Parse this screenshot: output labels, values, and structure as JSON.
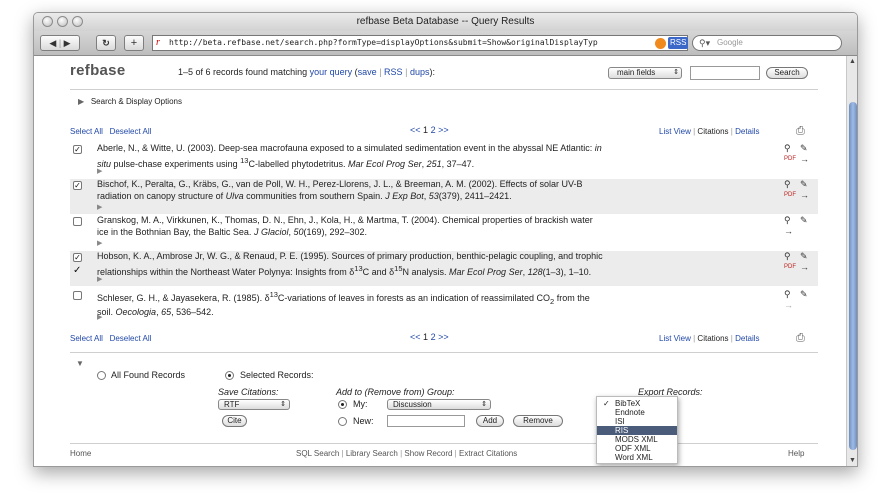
{
  "window": {
    "title": "refbase Beta Database -- Query Results",
    "url": "http://beta.refbase.net/search.php?formType=displayOptions&submit=Show&originalDisplayTyp",
    "rss_badge": "RSS",
    "search_placeholder": "Google"
  },
  "header": {
    "logo": "refbase",
    "summary_prefix": "1–5 of 6 records found matching",
    "your_query": "your query",
    "save": "save",
    "rss": "RSS",
    "dups": "dups",
    "field_select": "main fields",
    "search_button": "Search"
  },
  "search_display_options": "Search & Display Options",
  "selection": {
    "select_all": "Select All",
    "deselect_all": "Deselect All",
    "prev": "<<",
    "page_current": "1",
    "page_next": "2",
    "next": ">>",
    "list_view": "List View",
    "citations": "Citations",
    "details": "Details"
  },
  "records": [
    {
      "checked": true,
      "line1": "Aberle, N., & Witte, U. (2003). Deep-sea macrofauna exposed to a simulated sedimentation event in the abyssal NE Atlantic:",
      "line1_ital": "in",
      "line2_ital": "situ",
      "line2": "pulse-chase experiments using",
      "sup": "13",
      "line2b": "C-labelled phytodetritus.",
      "journal": "Mar Ecol Prog Ser",
      "vol": "251",
      "pages": ", 37–47."
    },
    {
      "checked": true,
      "line1": "Bischof, K., Peralta, G., Kräbs, G., van de Poll, W. H., Perez-Llorens, J. L., & Breeman, A. M. (2002). Effects of solar UV-B",
      "line2": "radiation on canopy structure of",
      "line2_ital": "Ulva",
      "line2b": "communities from southern Spain.",
      "journal": "J Exp Bot",
      "vol": "53",
      "pages": "(379), 2411–2421."
    },
    {
      "checked": false,
      "line1": "Granskog, M. A., Virkkunen, K., Thomas, D. N., Ehn, J., Kola, H., & Martma, T. (2004). Chemical properties of brackish water",
      "line2": "ice in the Bothnian Bay, the Baltic Sea.",
      "journal": "J Glaciol",
      "vol": "50",
      "pages": "(169), 292–302."
    },
    {
      "checked": true,
      "line1": "Hobson, K. A., Ambrose Jr, W. G., & Renaud, P. E. (1995). Sources of primary production, benthic-pelagic coupling, and trophic",
      "line2": "relationships within the Northeast Water Polynya: Insights from δ",
      "sup": "13",
      "line2b": "C and δ",
      "sup2": "15",
      "line2c": "N analysis.",
      "journal": "Mar Ecol Prog Ser",
      "vol": "128",
      "pages": "(1–3), 1–10."
    },
    {
      "checked": false,
      "line1": "Schleser, G. H., & Jayasekera, R. (1985). δ",
      "sup": "13",
      "line1b": "C-variations of leaves in forests as an indication of reassimilated CO",
      "sub": "2",
      "line1c": "from the",
      "line2": "soil.",
      "journal": "Oecologia",
      "vol": "65",
      "pages": ", 536–542."
    }
  ],
  "icons": {
    "pdf": "PDF"
  },
  "options": {
    "all_found": "All Found Records",
    "selected": "Selected Records:",
    "save_citations": "Save Citations:",
    "save_format": "RTF",
    "cite": "Cite",
    "group_header": "Add to (Remove from) Group:",
    "my": "My:",
    "group_value": "Discussion",
    "new": "New:",
    "add": "Add",
    "remove": "Remove",
    "export_header": "Export Records:",
    "export_options": [
      "BibTeX",
      "Endnote",
      "ISI",
      "RIS",
      "MODS XML",
      "ODF XML",
      "Word XML"
    ],
    "export_checked": "BibTeX",
    "export_highlight": "RIS"
  },
  "footer": {
    "home": "Home",
    "sql_search": "SQL Search",
    "library_search": "Library Search",
    "show_record": "Show Record",
    "extract_citations": "Extract Citations",
    "help": "Help"
  }
}
